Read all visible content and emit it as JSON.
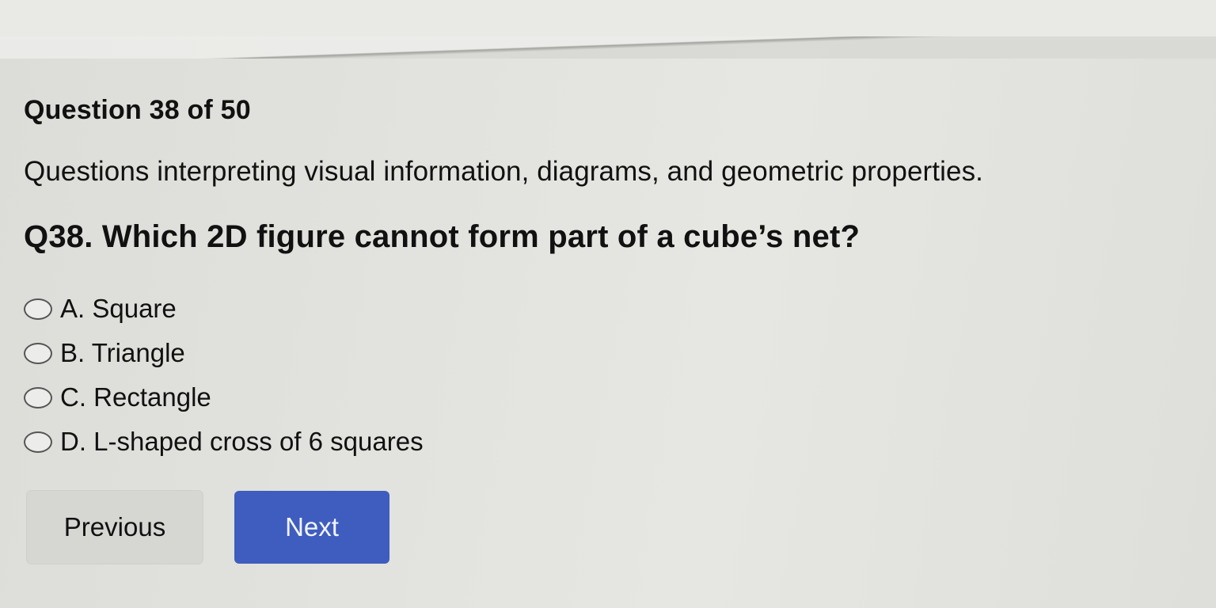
{
  "quiz": {
    "header": "Question 38 of 50",
    "section_description": "Questions interpreting visual information, diagrams, and geometric properties.",
    "question": "Q38. Which 2D figure cannot form part of a cube’s net?",
    "options": [
      {
        "label": "A. Square"
      },
      {
        "label": "B. Triangle"
      },
      {
        "label": "C. Rectangle"
      },
      {
        "label": "D. L-shaped cross of 6 squares"
      }
    ]
  },
  "navigation": {
    "previous_label": "Previous",
    "next_label": "Next"
  },
  "colors": {
    "background": "#e2e2de",
    "next_button": "#3f5dbe",
    "previous_button": "#d6d6d3"
  }
}
